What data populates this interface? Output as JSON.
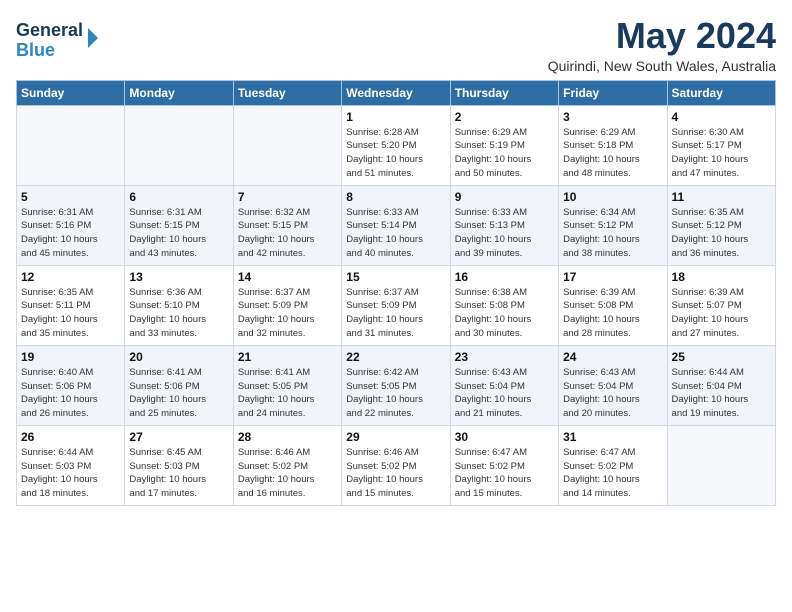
{
  "header": {
    "logo_line1": "General",
    "logo_line2": "Blue",
    "month": "May 2024",
    "location": "Quirindi, New South Wales, Australia"
  },
  "weekdays": [
    "Sunday",
    "Monday",
    "Tuesday",
    "Wednesday",
    "Thursday",
    "Friday",
    "Saturday"
  ],
  "weeks": [
    [
      {
        "day": "",
        "info": ""
      },
      {
        "day": "",
        "info": ""
      },
      {
        "day": "",
        "info": ""
      },
      {
        "day": "1",
        "info": "Sunrise: 6:28 AM\nSunset: 5:20 PM\nDaylight: 10 hours\nand 51 minutes."
      },
      {
        "day": "2",
        "info": "Sunrise: 6:29 AM\nSunset: 5:19 PM\nDaylight: 10 hours\nand 50 minutes."
      },
      {
        "day": "3",
        "info": "Sunrise: 6:29 AM\nSunset: 5:18 PM\nDaylight: 10 hours\nand 48 minutes."
      },
      {
        "day": "4",
        "info": "Sunrise: 6:30 AM\nSunset: 5:17 PM\nDaylight: 10 hours\nand 47 minutes."
      }
    ],
    [
      {
        "day": "5",
        "info": "Sunrise: 6:31 AM\nSunset: 5:16 PM\nDaylight: 10 hours\nand 45 minutes."
      },
      {
        "day": "6",
        "info": "Sunrise: 6:31 AM\nSunset: 5:15 PM\nDaylight: 10 hours\nand 43 minutes."
      },
      {
        "day": "7",
        "info": "Sunrise: 6:32 AM\nSunset: 5:15 PM\nDaylight: 10 hours\nand 42 minutes."
      },
      {
        "day": "8",
        "info": "Sunrise: 6:33 AM\nSunset: 5:14 PM\nDaylight: 10 hours\nand 40 minutes."
      },
      {
        "day": "9",
        "info": "Sunrise: 6:33 AM\nSunset: 5:13 PM\nDaylight: 10 hours\nand 39 minutes."
      },
      {
        "day": "10",
        "info": "Sunrise: 6:34 AM\nSunset: 5:12 PM\nDaylight: 10 hours\nand 38 minutes."
      },
      {
        "day": "11",
        "info": "Sunrise: 6:35 AM\nSunset: 5:12 PM\nDaylight: 10 hours\nand 36 minutes."
      }
    ],
    [
      {
        "day": "12",
        "info": "Sunrise: 6:35 AM\nSunset: 5:11 PM\nDaylight: 10 hours\nand 35 minutes."
      },
      {
        "day": "13",
        "info": "Sunrise: 6:36 AM\nSunset: 5:10 PM\nDaylight: 10 hours\nand 33 minutes."
      },
      {
        "day": "14",
        "info": "Sunrise: 6:37 AM\nSunset: 5:09 PM\nDaylight: 10 hours\nand 32 minutes."
      },
      {
        "day": "15",
        "info": "Sunrise: 6:37 AM\nSunset: 5:09 PM\nDaylight: 10 hours\nand 31 minutes."
      },
      {
        "day": "16",
        "info": "Sunrise: 6:38 AM\nSunset: 5:08 PM\nDaylight: 10 hours\nand 30 minutes."
      },
      {
        "day": "17",
        "info": "Sunrise: 6:39 AM\nSunset: 5:08 PM\nDaylight: 10 hours\nand 28 minutes."
      },
      {
        "day": "18",
        "info": "Sunrise: 6:39 AM\nSunset: 5:07 PM\nDaylight: 10 hours\nand 27 minutes."
      }
    ],
    [
      {
        "day": "19",
        "info": "Sunrise: 6:40 AM\nSunset: 5:06 PM\nDaylight: 10 hours\nand 26 minutes."
      },
      {
        "day": "20",
        "info": "Sunrise: 6:41 AM\nSunset: 5:06 PM\nDaylight: 10 hours\nand 25 minutes."
      },
      {
        "day": "21",
        "info": "Sunrise: 6:41 AM\nSunset: 5:05 PM\nDaylight: 10 hours\nand 24 minutes."
      },
      {
        "day": "22",
        "info": "Sunrise: 6:42 AM\nSunset: 5:05 PM\nDaylight: 10 hours\nand 22 minutes."
      },
      {
        "day": "23",
        "info": "Sunrise: 6:43 AM\nSunset: 5:04 PM\nDaylight: 10 hours\nand 21 minutes."
      },
      {
        "day": "24",
        "info": "Sunrise: 6:43 AM\nSunset: 5:04 PM\nDaylight: 10 hours\nand 20 minutes."
      },
      {
        "day": "25",
        "info": "Sunrise: 6:44 AM\nSunset: 5:04 PM\nDaylight: 10 hours\nand 19 minutes."
      }
    ],
    [
      {
        "day": "26",
        "info": "Sunrise: 6:44 AM\nSunset: 5:03 PM\nDaylight: 10 hours\nand 18 minutes."
      },
      {
        "day": "27",
        "info": "Sunrise: 6:45 AM\nSunset: 5:03 PM\nDaylight: 10 hours\nand 17 minutes."
      },
      {
        "day": "28",
        "info": "Sunrise: 6:46 AM\nSunset: 5:02 PM\nDaylight: 10 hours\nand 16 minutes."
      },
      {
        "day": "29",
        "info": "Sunrise: 6:46 AM\nSunset: 5:02 PM\nDaylight: 10 hours\nand 15 minutes."
      },
      {
        "day": "30",
        "info": "Sunrise: 6:47 AM\nSunset: 5:02 PM\nDaylight: 10 hours\nand 15 minutes."
      },
      {
        "day": "31",
        "info": "Sunrise: 6:47 AM\nSunset: 5:02 PM\nDaylight: 10 hours\nand 14 minutes."
      },
      {
        "day": "",
        "info": ""
      }
    ]
  ]
}
